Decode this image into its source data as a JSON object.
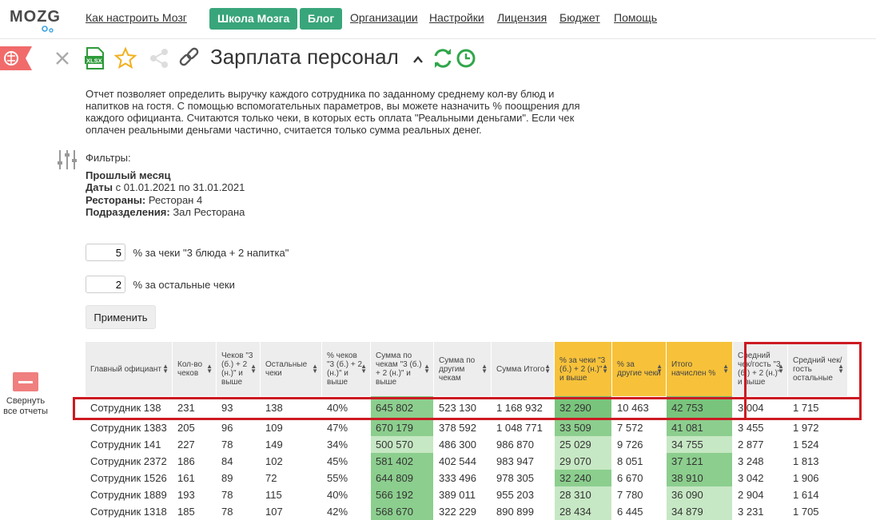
{
  "header": {
    "logo": "MOZG",
    "nav": [
      {
        "label": "Как настроить Мозг",
        "type": "link"
      },
      {
        "label": "Школа Мозга",
        "type": "button"
      },
      {
        "label": "Блог",
        "type": "button"
      },
      {
        "label": "Организации",
        "type": "link"
      },
      {
        "label": "Настройки",
        "type": "link"
      },
      {
        "label": "Лицензия",
        "type": "link"
      },
      {
        "label": "Бюджет",
        "type": "link"
      },
      {
        "label": "Помощь",
        "type": "link"
      }
    ]
  },
  "report": {
    "title": "Зарплата персонал",
    "xlsx_label": "XLSX",
    "description": "Отчет позволяет определить выручку каждого сотрудника по заданному среднему кол-ву блюд и напитков на гостя. С помощью вспомогательных параметров, вы можете назначить % поощрения для каждого официанта. Считаются только чеки, в которых есть оплата \"Реальными деньгами\". Если чек оплачен реальными деньгами частично, считается только сумма реальных денег."
  },
  "filters": {
    "heading": "Фильтры:",
    "period": "Прошлый месяц",
    "dates_label": "Даты",
    "dates_value": " с 01.01.2021 по 31.01.2021",
    "restaurants_label": "Рестораны:",
    "restaurants_value": " Ресторан 4",
    "divisions_label": "Подразделения:",
    "divisions_value": " Зал Ресторана"
  },
  "params": {
    "p1_value": "5",
    "p1_label": "% за чеки \"3 блюда + 2 напитка\"",
    "p2_value": "2",
    "p2_label": "% за остальные чеки",
    "apply": "Применить"
  },
  "sidebar": {
    "collapse_label": "Свернуть все отчеты"
  },
  "table": {
    "columns": [
      "Главный официант",
      "Кол-во чеков",
      "Чеков \"3 (б.) + 2 (н.)\" и выше",
      "Остальные чеки",
      "% чеков \"3 (б.) + 2 (н.)\" и выше",
      "Сумма по чекам \"3 (б.) + 2 (н.)\" и выше",
      "Сумма по другим чекам",
      "Сумма Итого",
      "% за чеки \"3 (б.) + 2 (н.)\" и выше",
      "% за другие чеки",
      "Итого начислен %",
      "Средний чек/гость \"3 (б.) + 2 (н.)\" и выше",
      "Средний чек/гость остальные"
    ],
    "rows": [
      [
        "Сотрудник 138",
        "231",
        "93",
        "138",
        "40%",
        "645 802",
        "523 130",
        "1 168 932",
        "32 290",
        "10 463",
        "42 753",
        "3 004",
        "1 715"
      ],
      [
        "Сотрудник 1383",
        "205",
        "96",
        "109",
        "47%",
        "670 179",
        "378 592",
        "1 048 771",
        "33 509",
        "7 572",
        "41 081",
        "3 455",
        "1 972"
      ],
      [
        "Сотрудник 141",
        "227",
        "78",
        "149",
        "34%",
        "500 570",
        "486 300",
        "986 870",
        "25 029",
        "9 726",
        "34 755",
        "2 877",
        "1 524"
      ],
      [
        "Сотрудник 2372",
        "186",
        "84",
        "102",
        "45%",
        "581 402",
        "402 544",
        "983 947",
        "29 070",
        "8 051",
        "37 121",
        "3 248",
        "1 813"
      ],
      [
        "Сотрудник 1526",
        "161",
        "89",
        "72",
        "55%",
        "644 809",
        "333 496",
        "978 305",
        "32 240",
        "6 670",
        "38 910",
        "3 042",
        "1 906"
      ],
      [
        "Сотрудник 1889",
        "193",
        "78",
        "115",
        "40%",
        "566 192",
        "389 011",
        "955 203",
        "28 310",
        "7 780",
        "36 090",
        "2 904",
        "1 614"
      ],
      [
        "Сотрудник 1318",
        "185",
        "78",
        "107",
        "42%",
        "568 670",
        "322 229",
        "890 899",
        "28 434",
        "6 445",
        "34 879",
        "3 231",
        "1 705"
      ]
    ]
  },
  "colors": {
    "brand_green": "#39a57a",
    "highlight_red": "#cc1a22",
    "header_yellow": "#f7c23a",
    "cell_green": "#8cce8e"
  }
}
